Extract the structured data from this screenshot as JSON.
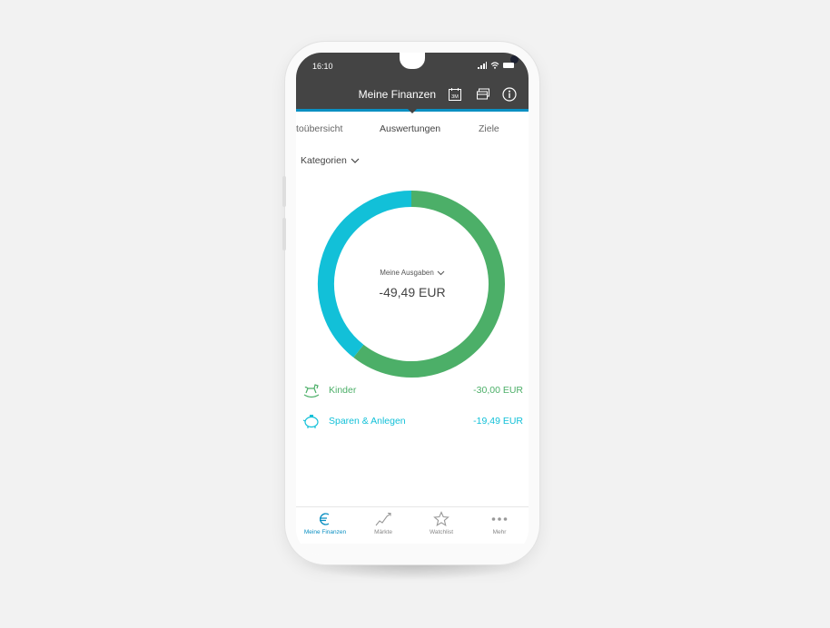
{
  "status_bar": {
    "time": "16:10"
  },
  "header": {
    "title": "Meine Finanzen",
    "period_icon_text": "3M"
  },
  "tabs": [
    {
      "label": "toübersicht",
      "active": false
    },
    {
      "label": "Auswertungen",
      "active": true
    },
    {
      "label": "Ziele",
      "active": false
    }
  ],
  "filter": {
    "label": "Kategorien"
  },
  "summary": {
    "label": "Meine Ausgaben",
    "total": "-49,49 EUR"
  },
  "chart_data": {
    "type": "pie",
    "categories": [
      "Kinder",
      "Sparen & Anlegen"
    ],
    "values": [
      30.0,
      19.49
    ],
    "colors": [
      "#4caf68",
      "#12c0d8"
    ],
    "center_label": "Meine Ausgaben",
    "center_value": "-49,49 EUR"
  },
  "categories": [
    {
      "name": "Kinder",
      "amount": "-30,00 EUR",
      "color": "#4caf68",
      "icon": "rocking-horse-icon"
    },
    {
      "name": "Sparen & Anlegen",
      "amount": "-19,49 EUR",
      "color": "#12c0d8",
      "icon": "piggy-bank-icon"
    }
  ],
  "bottom_nav": [
    {
      "label": "Meine Finanzen",
      "icon": "euro-icon",
      "active": true
    },
    {
      "label": "Märkte",
      "icon": "chart-trend-icon",
      "active": false
    },
    {
      "label": "Watchlist",
      "icon": "star-icon",
      "active": false
    },
    {
      "label": "Mehr",
      "icon": "more-dots-icon",
      "active": false
    }
  ],
  "colors": {
    "header_bg": "#444444",
    "accent": "#0a8fc2",
    "green": "#4caf68",
    "cyan": "#12c0d8"
  }
}
